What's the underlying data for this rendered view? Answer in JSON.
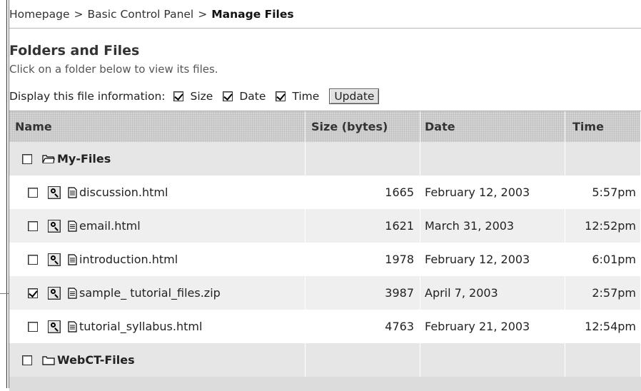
{
  "breadcrumb": {
    "items": [
      "Homepage",
      "Basic Control Panel"
    ],
    "current": "Manage Files",
    "separator": ">"
  },
  "heading": "Folders and Files",
  "subheading": "Click on a folder below to view its files.",
  "display_options": {
    "label": "Display this file information:",
    "options": [
      {
        "label": "Size",
        "checked": true
      },
      {
        "label": "Date",
        "checked": true
      },
      {
        "label": "Time",
        "checked": true
      }
    ],
    "update_label": "Update"
  },
  "table": {
    "headers": {
      "name": "Name",
      "size": "Size (bytes)",
      "date": "Date",
      "time": "Time"
    },
    "folders": [
      {
        "name": "My-Files",
        "checked": false,
        "icon": "open-folder-icon"
      },
      {
        "name": "WebCT-Files",
        "checked": false,
        "icon": "folder-icon"
      }
    ],
    "files": [
      {
        "name": "discussion.html",
        "size": "1665",
        "date": "February 12, 2003",
        "time": "5:57pm",
        "checked": false
      },
      {
        "name": "email.html",
        "size": "1621",
        "date": "March 31, 2003",
        "time": "12:52pm",
        "checked": false
      },
      {
        "name": "introduction.html",
        "size": "1978",
        "date": "February 12, 2003",
        "time": "6:01pm",
        "checked": false
      },
      {
        "name": "sample_ tutorial_files.zip",
        "size": "3987",
        "date": "April 7, 2003",
        "time": "2:57pm",
        "checked": true
      },
      {
        "name": "tutorial_syllabus.html",
        "size": "4763",
        "date": "February 21, 2003",
        "time": "12:54pm",
        "checked": false
      }
    ]
  },
  "colors": {
    "callout_line": "#6a72b8",
    "header_bg": "#d3d3d3",
    "alt_row": "#efefef"
  }
}
